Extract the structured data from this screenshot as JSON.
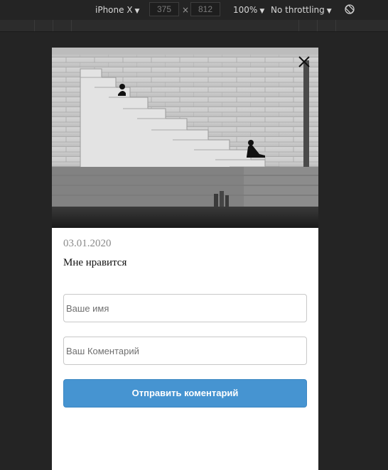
{
  "devtools": {
    "device": "iPhone X",
    "width": "375",
    "height": "812",
    "times": "×",
    "zoom": "100%",
    "throttling": "No throttling",
    "rotate_icon": "rotate-icon"
  },
  "post": {
    "image_alt": "photo",
    "date": "03.01.2020",
    "text": "Мне нравится"
  },
  "form": {
    "name_placeholder": "Ваше имя",
    "comment_placeholder": "Ваш Коментарий",
    "submit_label": "Отправить коментарий"
  },
  "colors": {
    "page_bg": "#242424",
    "button": "#4694d1"
  }
}
